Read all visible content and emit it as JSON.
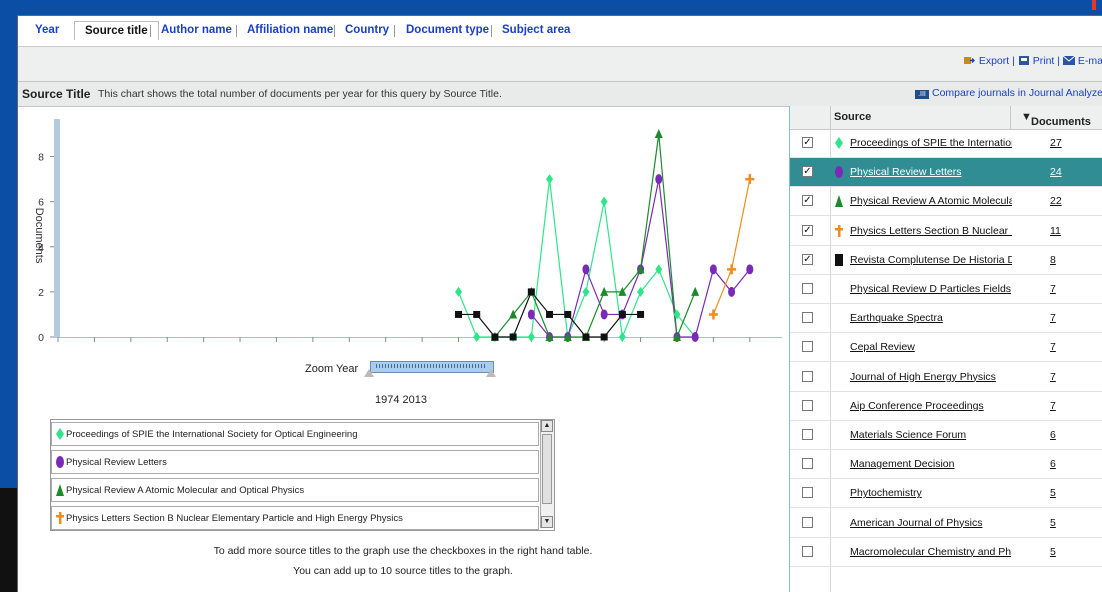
{
  "tabs": [
    "Year",
    "Source title",
    "Author name",
    "Affiliation name",
    "Country",
    "Document type",
    "Subject area"
  ],
  "active_tab": "Source title",
  "toolbar": {
    "export": "Export",
    "print": "Print",
    "email": "E-ma"
  },
  "titlebar": {
    "title": "Source Title",
    "description": "This chart shows the total number of documents per year for this query by Source Title.",
    "compare": "Compare journals in Journal Analyze"
  },
  "chart_data": {
    "type": "line",
    "ylabel": "Documents",
    "ylim": [
      0,
      9
    ],
    "yticks": [
      0,
      2,
      4,
      6,
      8
    ],
    "xlim": [
      1974,
      2013
    ],
    "xticks": [
      1974,
      1976,
      1978,
      1980,
      1982,
      1984,
      1986,
      1988,
      1990,
      1992,
      1994,
      1996,
      1998,
      2000,
      2002,
      2004,
      2006,
      2008,
      2010,
      2012
    ],
    "series": [
      {
        "name": "Proceedings of SPIE the International Society for Optical Engineering",
        "color": "#2ee58a",
        "marker": "diamond",
        "points": [
          [
            1996,
            2
          ],
          [
            1997,
            0
          ],
          [
            1998,
            0
          ],
          [
            1999,
            0
          ],
          [
            2000,
            0
          ],
          [
            2001,
            7
          ],
          [
            2002,
            0
          ],
          [
            2003,
            2
          ],
          [
            2004,
            6
          ],
          [
            2005,
            0
          ],
          [
            2006,
            2
          ],
          [
            2007,
            3
          ],
          [
            2008,
            1
          ],
          [
            2009,
            0
          ]
        ]
      },
      {
        "name": "Physical Review Letters",
        "color": "#7a2bb6",
        "marker": "circle",
        "points": [
          [
            2000,
            1
          ],
          [
            2001,
            0
          ],
          [
            2002,
            0
          ],
          [
            2003,
            3
          ],
          [
            2004,
            1
          ],
          [
            2005,
            1
          ],
          [
            2006,
            3
          ],
          [
            2007,
            7
          ],
          [
            2008,
            0
          ],
          [
            2009,
            0
          ],
          [
            2010,
            3
          ],
          [
            2011,
            2
          ],
          [
            2012,
            3
          ]
        ]
      },
      {
        "name": "Physical Review A Atomic Molecular and Optical Physics",
        "color": "#1d8a2a",
        "marker": "triangle",
        "points": [
          [
            1998,
            0
          ],
          [
            1999,
            1
          ],
          [
            2000,
            2
          ],
          [
            2001,
            0
          ],
          [
            2002,
            0
          ],
          [
            2003,
            0
          ],
          [
            2004,
            2
          ],
          [
            2005,
            2
          ],
          [
            2006,
            3
          ],
          [
            2007,
            9
          ],
          [
            2008,
            0
          ],
          [
            2009,
            2
          ]
        ]
      },
      {
        "name": "Physics Letters Section B Nuclear Elementary Particle and High Energy Physics",
        "color": "#f08c1c",
        "marker": "cross",
        "points": [
          [
            2010,
            1
          ],
          [
            2011,
            3
          ],
          [
            2012,
            7
          ]
        ]
      },
      {
        "name": "Revista Complutense De Historia De America",
        "color": "#111111",
        "marker": "square",
        "points": [
          [
            1996,
            1
          ],
          [
            1997,
            1
          ],
          [
            1998,
            0
          ],
          [
            1999,
            0
          ],
          [
            2000,
            2
          ],
          [
            2001,
            1
          ],
          [
            2002,
            1
          ],
          [
            2003,
            0
          ],
          [
            2004,
            0
          ],
          [
            2005,
            1
          ],
          [
            2006,
            1
          ]
        ]
      }
    ]
  },
  "zoom": {
    "label": "Zoom Year",
    "range_text": "1974 2013"
  },
  "legend": [
    {
      "label": "Proceedings of SPIE the International Society for Optical Engineering",
      "marker": "diamond",
      "color": "#2ee58a"
    },
    {
      "label": "Physical Review Letters",
      "marker": "circle",
      "color": "#7a2bb6"
    },
    {
      "label": "Physical Review A Atomic Molecular and Optical Physics",
      "marker": "triangle",
      "color": "#1d8a2a"
    },
    {
      "label": "Physics Letters Section B Nuclear Elementary Particle and High Energy Physics",
      "marker": "cross",
      "color": "#f08c1c"
    }
  ],
  "notes": {
    "line1": "To add more source titles to the graph use the checkboxes in the right hand table.",
    "line2": "You can add up to 10 source titles to the graph."
  },
  "table": {
    "col_source": "Source",
    "col_docs": "Documents",
    "rows": [
      {
        "source": "Proceedings of SPIE the Internation",
        "docs": "27",
        "checked": true,
        "marker": "diamond",
        "color": "#2ee58a"
      },
      {
        "source": "Physical Review Letters",
        "docs": "24",
        "checked": true,
        "marker": "circle",
        "color": "#7a2bb6",
        "selected": true
      },
      {
        "source": "Physical Review A Atomic Molecula",
        "docs": "22",
        "checked": true,
        "marker": "triangle",
        "color": "#1d8a2a"
      },
      {
        "source": "Physics Letters Section B Nuclear E",
        "docs": "11",
        "checked": true,
        "marker": "cross",
        "color": "#f08c1c"
      },
      {
        "source": "Revista Complutense De Historia D",
        "docs": "8",
        "checked": true,
        "marker": "square",
        "color": "#111111"
      },
      {
        "source": "Physical Review D Particles Fields",
        "docs": "7",
        "checked": false
      },
      {
        "source": "Earthquake Spectra",
        "docs": "7",
        "checked": false
      },
      {
        "source": "Cepal Review",
        "docs": "7",
        "checked": false
      },
      {
        "source": "Journal of High Energy Physics",
        "docs": "7",
        "checked": false
      },
      {
        "source": "Aip Conference Proceedings",
        "docs": "7",
        "checked": false
      },
      {
        "source": "Materials Science Forum",
        "docs": "6",
        "checked": false
      },
      {
        "source": "Management Decision",
        "docs": "6",
        "checked": false
      },
      {
        "source": "Phytochemistry",
        "docs": "5",
        "checked": false
      },
      {
        "source": "American Journal of Physics",
        "docs": "5",
        "checked": false
      },
      {
        "source": "Macromolecular Chemistry and Ph",
        "docs": "5",
        "checked": false
      }
    ]
  }
}
